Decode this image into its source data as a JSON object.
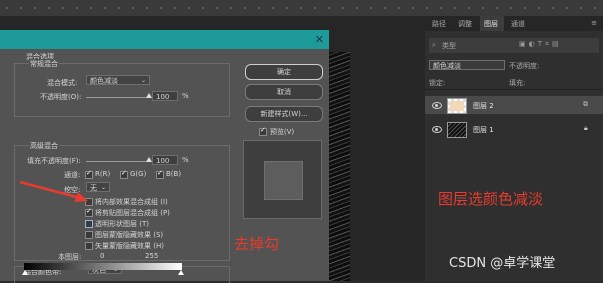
{
  "colors": {
    "dialog_title": "#1e9a9a",
    "annotation": "#e63b2e",
    "panel_bg": "#2f2f2f",
    "dialog_bg": "#535353"
  },
  "dialog": {
    "section_title": "混合选项",
    "general_blending": "常规混合",
    "blend_mode_label": "混合模式:",
    "blend_mode_value": "颜色减淡",
    "opacity_label": "不透明度(O):",
    "opacity_value": "100",
    "opacity_unit": "%",
    "advanced_blending": "高级混合",
    "fill_opacity_label": "填充不透明度(F):",
    "fill_opacity_value": "100",
    "fill_opacity_unit": "%",
    "channels_label": "通道:",
    "channel_r": "R(R)",
    "channel_g": "G(G)",
    "channel_b": "B(B)",
    "knockout_label": "挖空:",
    "knockout_value": "无",
    "options": [
      {
        "label": "将内部效果混合成组 (I)",
        "checked": false
      },
      {
        "label": "将剪贴图层混合成组 (P)",
        "checked": true
      },
      {
        "label": "透明形状图层 (T)",
        "checked": false
      },
      {
        "label": "图层蒙版隐藏效果 (S)",
        "checked": false
      },
      {
        "label": "矢量蒙版隐藏效果 (H)",
        "checked": false
      }
    ],
    "blend_if_label": "混合颜色带:",
    "blend_if_value": "灰色",
    "this_layer_label": "本图层:",
    "this_layer_min": "0",
    "this_layer_max": "255",
    "ok_button": "确定",
    "cancel_button": "取消",
    "new_style_button": "新建样式(W)...",
    "preview_label": "预览(V)",
    "preview_checked": true
  },
  "layers_panel": {
    "tabs": [
      "路径",
      "调整",
      "图层",
      "通道"
    ],
    "active_tab": "图层",
    "filter_placeholder": "类型",
    "blend_mode": "颜色减淡",
    "opacity_label": "不透明度:",
    "lock_label": "锁定:",
    "fill_label": "填充:",
    "layers": [
      {
        "name": "图层 2",
        "selected": true
      },
      {
        "name": "图层 1",
        "selected": false
      }
    ]
  },
  "annotations": {
    "remove_check": "去掉勾",
    "layer_note": "图层选颜色减淡"
  },
  "watermark": "CSDN @卓学课堂"
}
